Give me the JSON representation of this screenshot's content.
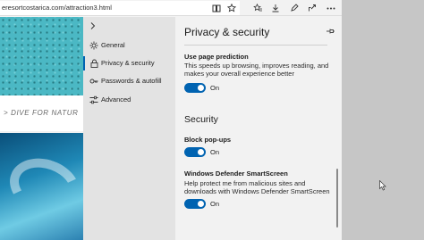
{
  "browser": {
    "url": "eresortcostarica.com/attraction3.html",
    "icons": [
      "reading-view-icon",
      "favorite-star-icon",
      "favorites-hub-icon",
      "ink-pen-icon",
      "share-icon",
      "more-icon"
    ]
  },
  "page": {
    "banner_text": "> DIVE FOR NATUR"
  },
  "menu": {
    "items": [
      {
        "label": "General",
        "icon": "gear-icon"
      },
      {
        "label": "Privacy & security",
        "icon": "lock-icon"
      },
      {
        "label": "Passwords & autofill",
        "icon": "key-icon"
      },
      {
        "label": "Advanced",
        "icon": "sliders-icon"
      }
    ]
  },
  "panel": {
    "title": "Privacy & security",
    "page_prediction": {
      "heading": "Use page prediction",
      "description": "This speeds up browsing, improves reading, and makes your overall experience better",
      "toggle_label": "On"
    },
    "security_title": "Security",
    "block_popups": {
      "heading": "Block pop-ups",
      "toggle_label": "On"
    },
    "smartscreen": {
      "heading": "Windows Defender SmartScreen",
      "description": "Help protect me from malicious sites and downloads with Windows Defender SmartScreen",
      "toggle_label": "On"
    }
  },
  "colors": {
    "accent": "#0063b1",
    "menu_bg": "#e3e3e3",
    "panel_bg": "#f2f2f2",
    "desktop_bg": "#c6c6c6"
  }
}
